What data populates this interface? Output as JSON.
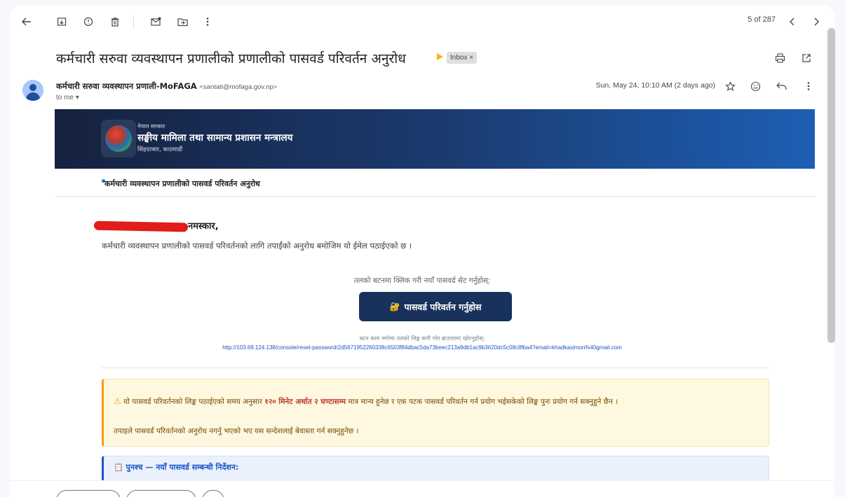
{
  "toolbar": {
    "back_icon": "arrow-left-icon",
    "archive_icon": "archive-icon",
    "report_spam_icon": "report-icon",
    "delete_icon": "trash-icon",
    "mark_unread_icon": "mail-unread-icon",
    "move_to_icon": "folder-move-icon",
    "more_icon": "more-vert-icon",
    "pager": "5 of 287",
    "prev_icon": "chevron-left-icon",
    "next_icon": "chevron-right-icon"
  },
  "subject": {
    "text": "कर्मचारी सरुवा व्यवस्थापन प्रणालीको प्रणालीको पासवर्ड परिवर्तन अनुरोध",
    "label": "Inbox ×",
    "print_icon": "print-icon",
    "open_new_window_icon": "open-in-new-icon"
  },
  "sender": {
    "name": "कर्मचारी सरुवा व्यवस्थापन प्रणाली-MoFAGA",
    "email": "<santati@mofaga.gov.np>",
    "to": "to me ▾",
    "date": "Sun, May 24, 10:10 AM (2 days ago)",
    "star_icon": "star-icon",
    "emoji_icon": "emoji-icon",
    "reply_icon": "reply-icon",
    "more_icon": "more-vert-icon"
  },
  "banner": {
    "small_line": "नेपाल सरकार",
    "title": "सङ्घीय मामिला तथा सामान्य प्रशासन मन्त्रालय",
    "address": "सिंहदरबार, काठमाडौं"
  },
  "email": {
    "subheading": "कर्मचारी व्यवस्थापन प्रणालीको पासवर्ड परिवर्तन अनुरोध",
    "greeting": "नमस्कार,",
    "paragraph": "कर्मचारी व्यवस्थापन प्रणालीको पासवर्ड परिवर्तनको लागि तपाईंको अनुरोध बमोजिम यो ईमेल पठाईएको छ ।",
    "instruction": "तलको बटनमा क्लिक गरी नयाँ पासवर्ड सेट गर्नुहोस्:",
    "cta_label": "पासवर्ड परिवर्तन गर्नुहोस",
    "cta_icon": "lock-key-icon",
    "fallback": "बटन काम नगरेमा तलको लिङ्क कपी गरेर ब्राउजरमा खोल्नुहोस्:",
    "link": "http://103.69.124.138/console/reset-password/2d5671952260338c6503f84dbac5da73beec213a9db1ac9b3620dc5c08c8fba4?email=khadkasimon%40gmail.com"
  },
  "warning": {
    "line1_pre": "यो पासवर्ड परिवर्तनको लिङ्क पठाईएको समय अनुसार",
    "line1_bold": "१२० मिनेट अर्थात २ घण्टासम्म",
    "line1_post": "मात्र मान्य हुनेछ र एक पटक पासवर्ड परिवर्तन गर्न प्रयोग भईसकेको लिङ्क पुनः प्रयोग गर्न सक्नुहुने छैन ।",
    "line2": "तपाइले पासवर्ड परिवर्तनको अनुरोध नगर्नु भएको भए यस सन्देशलाई बेवास्ता गर्न सक्नुहुनेछ ।"
  },
  "ps": {
    "title": "📋 पुनश्च — नयाँ पासवर्ड सम्बन्धी निर्देशन:"
  }
}
